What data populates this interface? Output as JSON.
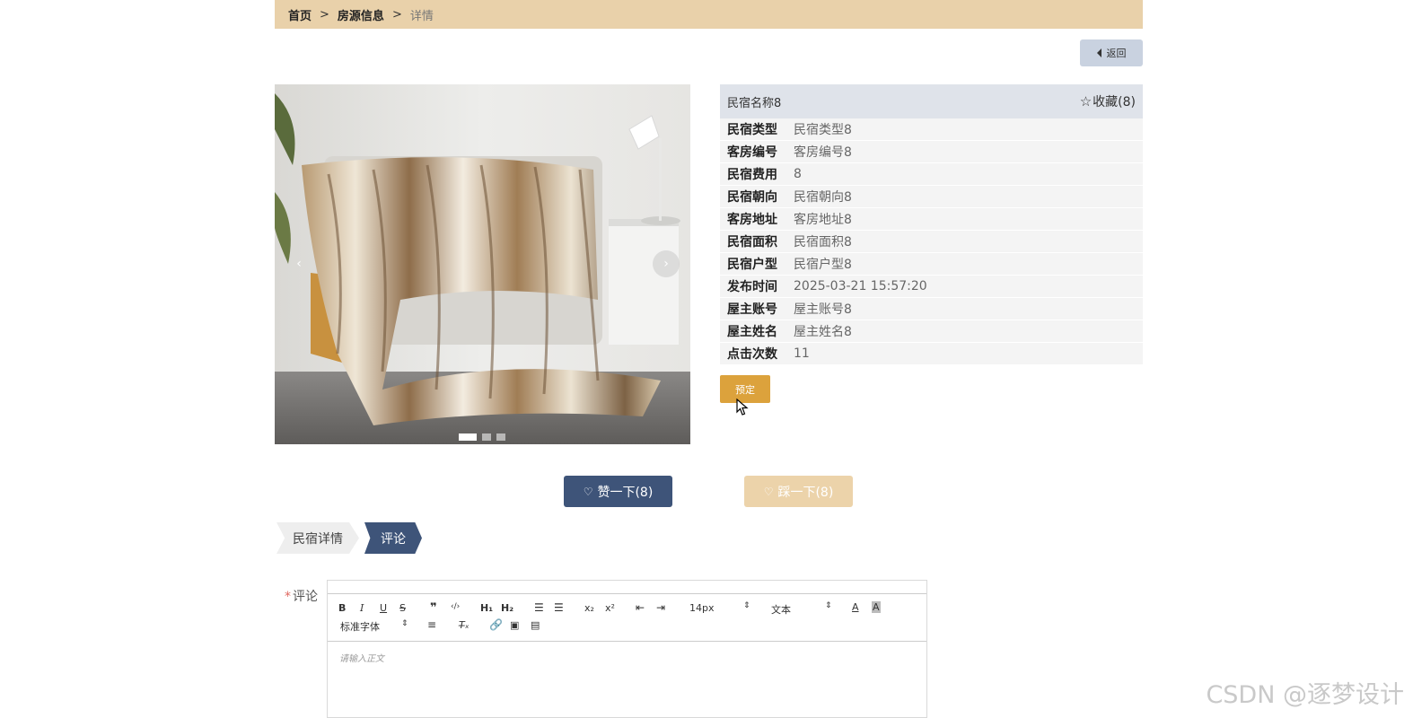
{
  "breadcrumb": {
    "home": "首页",
    "section": "房源信息",
    "current": "详情",
    "sep": ">"
  },
  "back_button": {
    "label": "返回"
  },
  "carousel": {
    "prev": "‹",
    "next": "›",
    "slide_count": 3,
    "active_index": 0
  },
  "listing": {
    "name": "民宿名称8",
    "favorite_label": "收藏(8)",
    "fields": [
      {
        "key": "民宿类型",
        "value": "民宿类型8"
      },
      {
        "key": "客房编号",
        "value": "客房编号8"
      },
      {
        "key": "民宿费用",
        "value": "8"
      },
      {
        "key": "民宿朝向",
        "value": "民宿朝向8"
      },
      {
        "key": "客房地址",
        "value": "客房地址8"
      },
      {
        "key": "民宿面积",
        "value": "民宿面积8"
      },
      {
        "key": "民宿户型",
        "value": "民宿户型8"
      },
      {
        "key": "发布时间",
        "value": "2025-03-21 15:57:20"
      },
      {
        "key": "屋主账号",
        "value": "屋主账号8"
      },
      {
        "key": "屋主姓名",
        "value": "屋主姓名8"
      },
      {
        "key": "点击次数",
        "value": "11"
      }
    ],
    "book_button": "预定"
  },
  "actions": {
    "like": "赞一下(8)",
    "dislike": "踩一下(8)"
  },
  "tabs": {
    "detail": "民宿详情",
    "comment": "评论"
  },
  "comment_form": {
    "label": "评论",
    "required_mark": "*",
    "font_size": "14px",
    "text_style": "文本",
    "font_family": "标准字体",
    "placeholder": "请输入正文"
  },
  "watermark": "CSDN @逐梦设计",
  "colors": {
    "breadcrumb_bg": "#e9d1aa",
    "primary": "#3e5479",
    "accent": "#dca23c",
    "dislike_bg": "#ecd3aa"
  }
}
